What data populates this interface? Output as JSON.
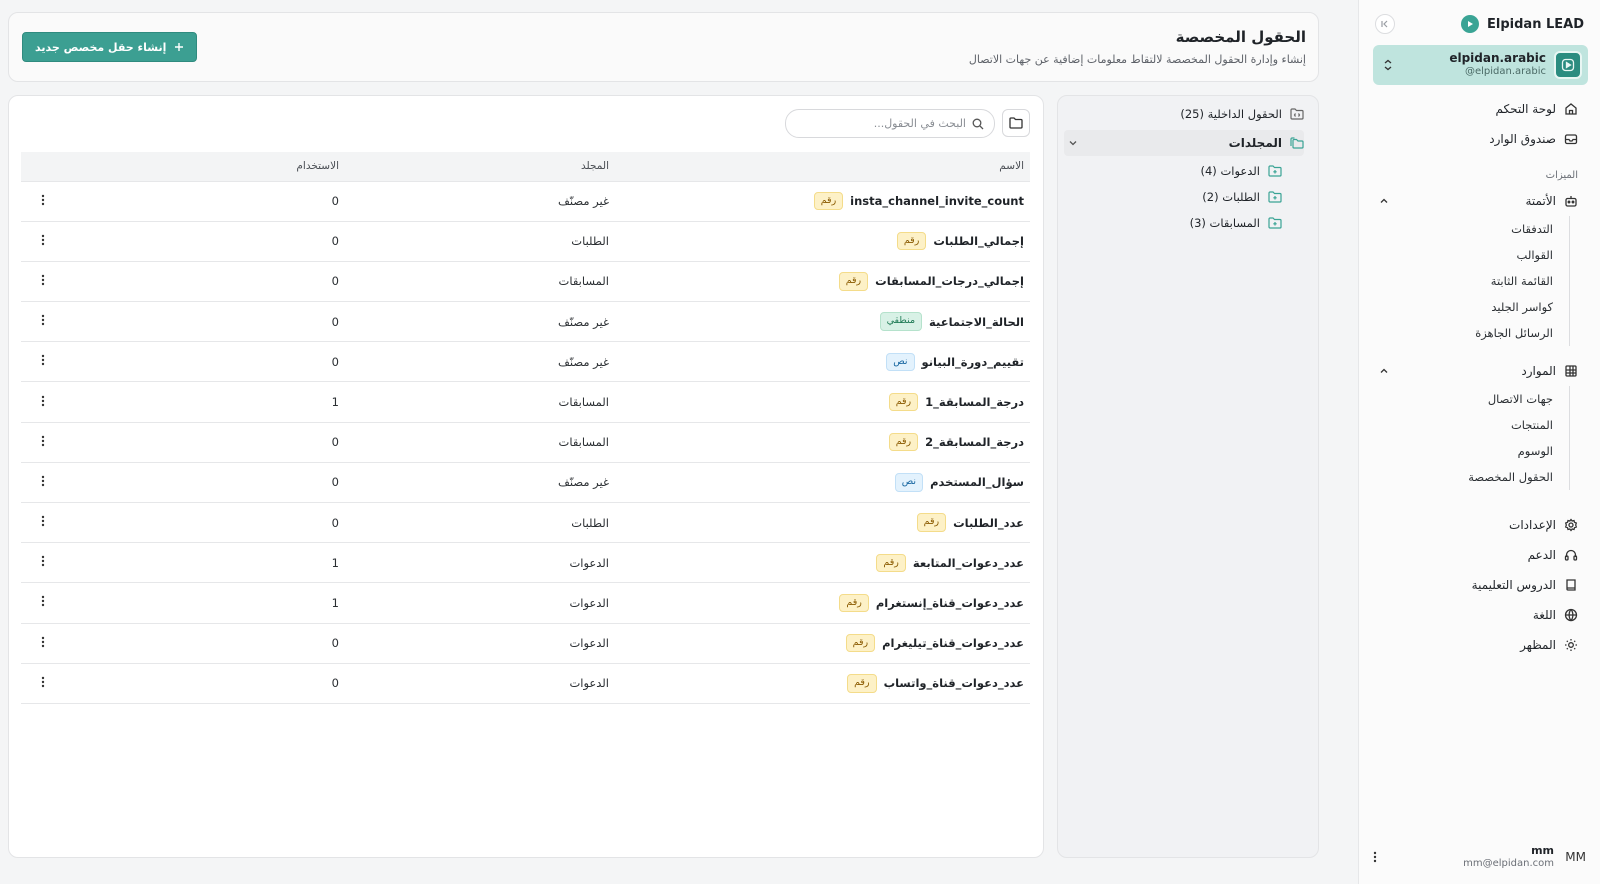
{
  "app": {
    "brand": "Elpidan LEAD",
    "account_name": "elpidan.arabic",
    "account_handle": "@elpidan.arabic"
  },
  "sidebar": {
    "dashboard": "لوحة التحكم",
    "inbox": "صندوق الوارد",
    "features_label": "الميزات",
    "automation": {
      "label": "الأتمتة",
      "items": [
        "التدفقات",
        "القوالب",
        "القائمة الثابتة",
        "كواسر الجليد",
        "الرسائل الجاهزة"
      ]
    },
    "resources": {
      "label": "الموارد",
      "items": [
        "جهات الاتصال",
        "المنتجات",
        "الوسوم",
        "الحقول المخصصة"
      ]
    },
    "settings": "الإعدادات",
    "support": "الدعم",
    "tutorials": "الدروس التعليمية",
    "language": "اللغة",
    "appearance": "المظهر",
    "user": {
      "initials": "MM",
      "name": "mm",
      "email": "mm@elpidan.com"
    }
  },
  "header": {
    "title": "الحقول المخصصة",
    "subtitle": "إنشاء وإدارة الحقول المخصصة لالتقاط معلومات إضافية عن جهات الاتصال",
    "create_button": "إنشاء حقل مخصص جديد"
  },
  "tree": {
    "internal": "الحقول الداخلية (25)",
    "folders_label": "المجلدات",
    "folders": [
      "الدعوات (4)",
      "الطلبات (2)",
      "المسابقات (3)"
    ]
  },
  "search": {
    "placeholder": "البحث في الحقول..."
  },
  "table": {
    "columns": {
      "name": "الاسم",
      "folder": "المجلد",
      "usage": "الاستخدام"
    },
    "rows": [
      {
        "name": "insta_channel_invite_count",
        "type": "رقم",
        "type_key": "number",
        "folder": "غير مصنّف",
        "usage": "0"
      },
      {
        "name": "إجمالي_الطلبات",
        "type": "رقم",
        "type_key": "number",
        "folder": "الطلبات",
        "usage": "0"
      },
      {
        "name": "إجمالي_درجات_المسابقات",
        "type": "رقم",
        "type_key": "number",
        "folder": "المسابقات",
        "usage": "0"
      },
      {
        "name": "الحالة_الاجتماعية",
        "type": "منطقي",
        "type_key": "boolean",
        "folder": "غير مصنّف",
        "usage": "0"
      },
      {
        "name": "تقييم_دورة_البيانو",
        "type": "نص",
        "type_key": "text",
        "folder": "غير مصنّف",
        "usage": "0"
      },
      {
        "name": "درجة_المسابقة_1",
        "type": "رقم",
        "type_key": "number",
        "folder": "المسابقات",
        "usage": "1"
      },
      {
        "name": "درجة_المسابقة_2",
        "type": "رقم",
        "type_key": "number",
        "folder": "المسابقات",
        "usage": "0"
      },
      {
        "name": "سؤال_المستخدم",
        "type": "نص",
        "type_key": "text",
        "folder": "غير مصنّف",
        "usage": "0"
      },
      {
        "name": "عدد_الطلبات",
        "type": "رقم",
        "type_key": "number",
        "folder": "الطلبات",
        "usage": "0"
      },
      {
        "name": "عدد_دعوات_المتابعة",
        "type": "رقم",
        "type_key": "number",
        "folder": "الدعوات",
        "usage": "1"
      },
      {
        "name": "عدد_دعوات_قناة_إنستغرام",
        "type": "رقم",
        "type_key": "number",
        "folder": "الدعوات",
        "usage": "1"
      },
      {
        "name": "عدد_دعوات_قناة_تيليغرام",
        "type": "رقم",
        "type_key": "number",
        "folder": "الدعوات",
        "usage": "0"
      },
      {
        "name": "عدد_دعوات_قناة_واتساب",
        "type": "رقم",
        "type_key": "number",
        "folder": "الدعوات",
        "usage": "0"
      }
    ]
  },
  "colors": {
    "accent": "#3c9f92",
    "account_bg": "#bfe4de"
  }
}
